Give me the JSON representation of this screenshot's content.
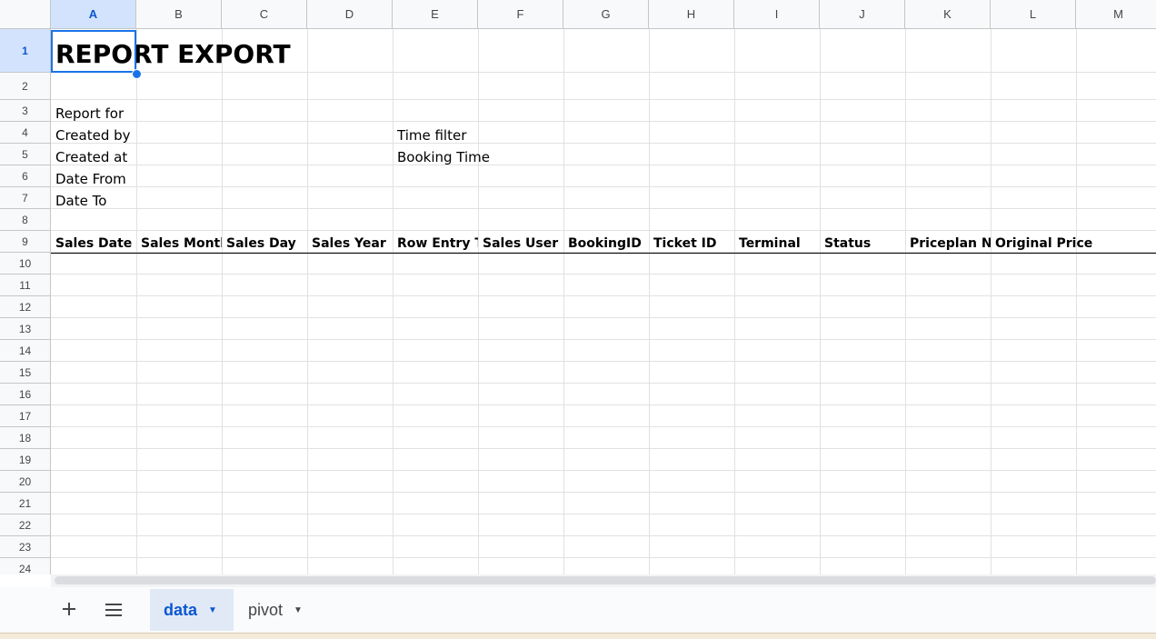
{
  "columns": [
    "A",
    "B",
    "C",
    "D",
    "E",
    "F",
    "G",
    "H",
    "I",
    "J",
    "K",
    "L",
    "M"
  ],
  "rows": [
    "1",
    "2",
    "3",
    "4",
    "5",
    "6",
    "7",
    "8",
    "9",
    "10",
    "11",
    "12",
    "13",
    "14",
    "15",
    "16",
    "17",
    "18",
    "19",
    "20",
    "21",
    "22",
    "23",
    "24"
  ],
  "selected_cell": "A1",
  "cells": {
    "title": "REPORT EXPORT",
    "report_for": "Report for",
    "created_by": "Created by",
    "created_at": "Created at",
    "date_from": "Date From",
    "date_to": "Date To",
    "time_filter": "Time filter",
    "booking_time": "Booking Time"
  },
  "table_headers": [
    "Sales Date",
    "Sales Month",
    "Sales Day",
    "Sales Year",
    "Row Entry Time",
    "Sales User",
    "BookingID",
    "Ticket ID",
    "Terminal",
    "Status",
    "Priceplan Name",
    "Original Price"
  ],
  "tabs": [
    {
      "label": "data",
      "active": true
    },
    {
      "label": "pivot",
      "active": false
    }
  ],
  "toolbar": {
    "add_sheet_icon": "plus-icon",
    "all_sheets_icon": "menu-lines-icon"
  },
  "colors": {
    "accent": "#0b57d0",
    "selection": "#1a73e8"
  }
}
